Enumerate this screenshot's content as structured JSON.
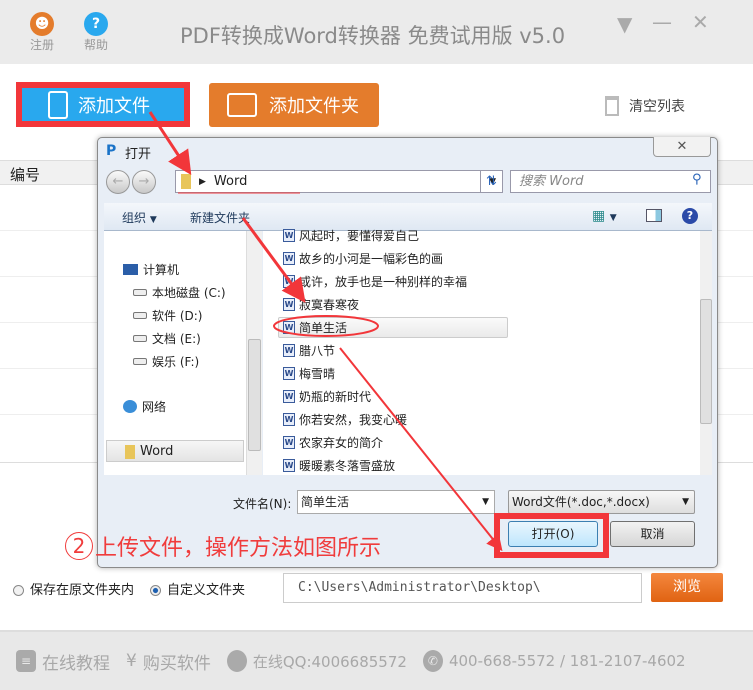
{
  "app": {
    "title": "PDF转换成Word转换器 免费试用版 v5.0",
    "register": "注册",
    "help": "帮助"
  },
  "toolbar": {
    "add_file": "添加文件",
    "add_folder": "添加文件夹",
    "clear_list": "清空列表"
  },
  "table": {
    "col_number": "编号"
  },
  "dialog": {
    "title": "打开",
    "address": "Word",
    "search_placeholder": "搜索 Word",
    "organize": "组织",
    "new_folder": "新建文件夹",
    "nav": [
      {
        "label": "计算机"
      },
      {
        "label": "本地磁盘 (C:)"
      },
      {
        "label": "软件 (D:)"
      },
      {
        "label": "文档 (E:)"
      },
      {
        "label": "娱乐 (F:)"
      },
      {
        "label": "网络"
      },
      {
        "label": "Word"
      }
    ],
    "files": [
      "风起时，要懂得爱自己",
      "故乡的小河是一幅彩色的画",
      "或许，放手也是一种别样的幸福",
      "寂寞春寒夜",
      "简单生活",
      "腊八节",
      "梅雪晴",
      "奶瓶的新时代",
      "你若安然，我变心暖",
      "农家弃女的简介",
      "暖暖素冬落雪盛放"
    ],
    "selected_file": "简单生活",
    "filename_label": "文件名(N):",
    "filename_value": "简单生活",
    "filter": "Word文件(*.doc,*.docx)",
    "open": "打开(O)",
    "cancel": "取消"
  },
  "annotation": {
    "step": "2",
    "text": "上传文件，操作方法如图所示",
    "color": "#f03c3c"
  },
  "output": {
    "keep_original": "保存在原文件夹内",
    "custom_folder": "自定义文件夹",
    "custom_selected": true,
    "path": "C:\\Users\\Administrator\\Desktop\\",
    "browse": "浏览"
  },
  "footer": {
    "tutorial": "在线教程",
    "buy": "购买软件",
    "qq": "在线QQ:4006685572",
    "phone": "400-668-5572 / 181-2107-4602"
  },
  "colors": {
    "blue": "#29a8ee",
    "orange": "#e47c2c",
    "highlight": "#f2363a"
  }
}
